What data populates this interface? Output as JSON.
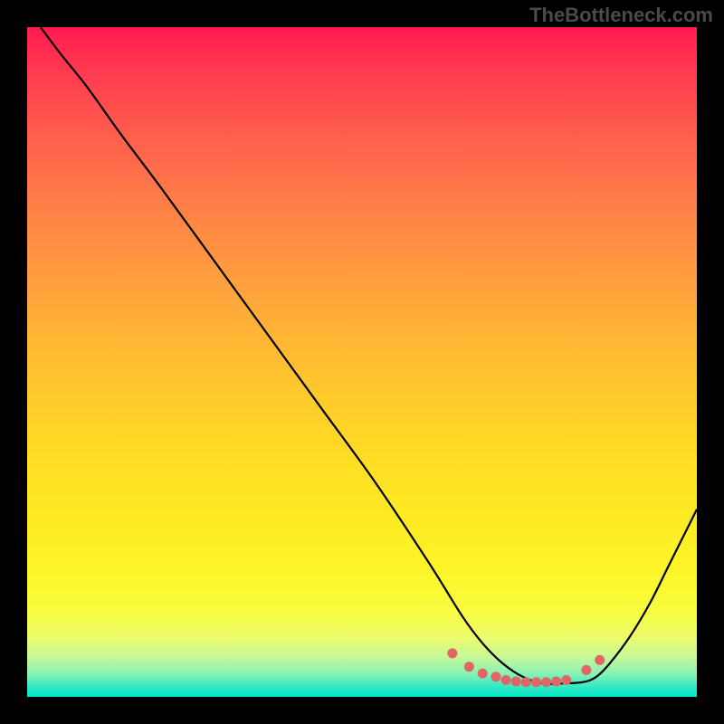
{
  "watermark": "TheBottleneck.com",
  "chart_data": {
    "type": "line",
    "title": "",
    "xlabel": "",
    "ylabel": "",
    "xlim": [
      0,
      100
    ],
    "ylim": [
      0,
      100
    ],
    "grid": false,
    "legend": false,
    "gradient_stops": [
      {
        "pos": 0,
        "color": "#ff1a52"
      },
      {
        "pos": 6,
        "color": "#ff3850"
      },
      {
        "pos": 15,
        "color": "#ff5a4d"
      },
      {
        "pos": 25,
        "color": "#ff7a48"
      },
      {
        "pos": 35,
        "color": "#ff9740"
      },
      {
        "pos": 45,
        "color": "#ffb236"
      },
      {
        "pos": 55,
        "color": "#ffca2c"
      },
      {
        "pos": 65,
        "color": "#ffde24"
      },
      {
        "pos": 75,
        "color": "#fded22"
      },
      {
        "pos": 82,
        "color": "#fbf72a"
      },
      {
        "pos": 87,
        "color": "#f8fc3f"
      },
      {
        "pos": 91,
        "color": "#edfb6a"
      },
      {
        "pos": 94,
        "color": "#c7f897"
      },
      {
        "pos": 96.5,
        "color": "#8af2b5"
      },
      {
        "pos": 98.5,
        "color": "#34e9c4"
      },
      {
        "pos": 100,
        "color": "#00e7c8"
      }
    ],
    "series": [
      {
        "name": "bottleneck-curve",
        "x": [
          2,
          5,
          9,
          14,
          20,
          28,
          36,
          44,
          52,
          60,
          65,
          68,
          71,
          74,
          77,
          80,
          83,
          85,
          87,
          90,
          93,
          96,
          100
        ],
        "y": [
          100,
          96,
          91,
          84,
          76,
          65,
          54,
          43,
          32,
          20,
          12,
          8,
          5,
          3,
          2,
          2,
          2.2,
          3,
          5,
          9,
          14,
          20,
          28
        ]
      }
    ],
    "markers": {
      "name": "highlight-dots",
      "color": "#e06666",
      "x": [
        63.5,
        66,
        68,
        70,
        71.5,
        73,
        74.5,
        76,
        77.5,
        79,
        80.5,
        83.5,
        85.5
      ],
      "y": [
        6.5,
        4.5,
        3.5,
        3,
        2.5,
        2.3,
        2.2,
        2.2,
        2.2,
        2.3,
        2.5,
        4,
        5.5
      ]
    }
  }
}
